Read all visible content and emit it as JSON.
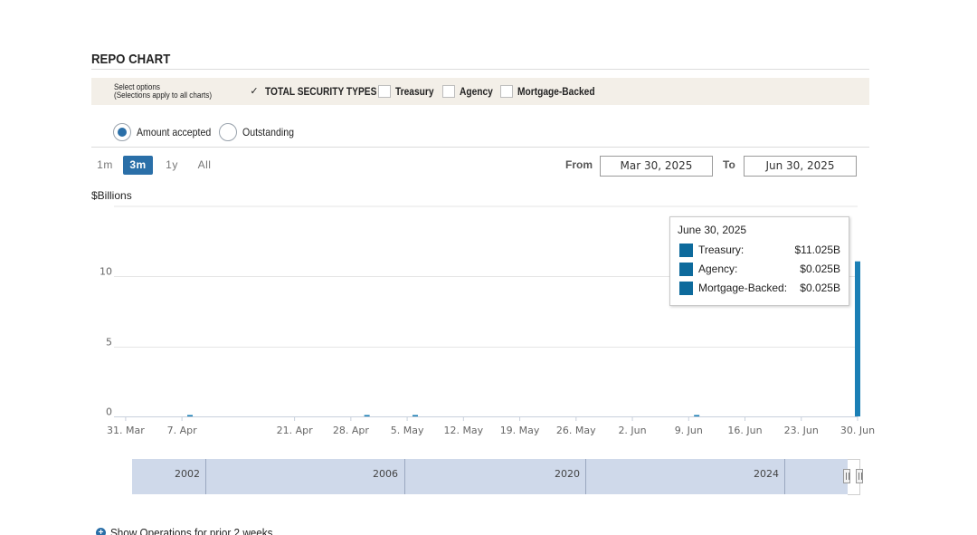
{
  "header": {
    "title": "REPO CHART"
  },
  "options": {
    "label_line1": "Select options",
    "label_line2": "(Selections apply to all charts)",
    "checkboxes": [
      {
        "label": "TOTAL SECURITY TYPES",
        "checked": true
      },
      {
        "label": "Treasury",
        "checked": false
      },
      {
        "label": "Agency",
        "checked": false
      },
      {
        "label": "Mortgage-Backed",
        "checked": false
      }
    ],
    "check_glyph": "✓"
  },
  "radios": [
    {
      "label": "Amount accepted",
      "selected": true
    },
    {
      "label": "Outstanding",
      "selected": false
    }
  ],
  "range_buttons": [
    {
      "label": "1m",
      "active": false
    },
    {
      "label": "3m",
      "active": true
    },
    {
      "label": "1y",
      "active": false
    },
    {
      "label": "All",
      "active": false
    }
  ],
  "date_range": {
    "from_label": "From",
    "from_value": "Mar 30, 2025",
    "to_label": "To",
    "to_value": "Jun 30, 2025"
  },
  "tooltip": {
    "date": "June 30, 2025",
    "rows": [
      {
        "name": "Treasury:",
        "value": "$11.025B"
      },
      {
        "name": "Agency:",
        "value": "$0.025B"
      },
      {
        "name": "Mortgage-Backed:",
        "value": "$0.025B"
      }
    ]
  },
  "navigator": {
    "years": [
      "2002",
      "2006",
      "2020",
      "2024"
    ]
  },
  "footer": {
    "ops_link": "Show Operations for prior 2 weeks",
    "ops_icon": "+"
  },
  "colors": {
    "accent": "#2a6fa8",
    "bar": "#1a7fb5",
    "tooltip_swatch": "#0d6a9c",
    "grid": "#e6e6e6",
    "navigator": "#cfd9ea"
  },
  "chart_data": {
    "type": "bar",
    "title": "",
    "ylabel": "$Billions",
    "xlabel": "",
    "x_range": [
      "2025-03-30",
      "2025-06-30"
    ],
    "ylim": [
      0,
      15
    ],
    "yticks": [
      0,
      5,
      10
    ],
    "xticks": [
      {
        "date": "2025-03-31",
        "label": "31. Mar"
      },
      {
        "date": "2025-04-07",
        "label": "7. Apr"
      },
      {
        "date": "2025-04-21",
        "label": "21. Apr"
      },
      {
        "date": "2025-04-28",
        "label": "28. Apr"
      },
      {
        "date": "2025-05-05",
        "label": "5. May"
      },
      {
        "date": "2025-05-12",
        "label": "12. May"
      },
      {
        "date": "2025-05-19",
        "label": "19. May"
      },
      {
        "date": "2025-05-26",
        "label": "26. May"
      },
      {
        "date": "2025-06-02",
        "label": "2. Jun"
      },
      {
        "date": "2025-06-09",
        "label": "9. Jun"
      },
      {
        "date": "2025-06-16",
        "label": "16. Jun"
      },
      {
        "date": "2025-06-23",
        "label": "23. Jun"
      },
      {
        "date": "2025-06-30",
        "label": "30. Jun"
      }
    ],
    "bars": [
      {
        "date": "2025-04-08",
        "value": 0.1
      },
      {
        "date": "2025-04-30",
        "value": 0.1
      },
      {
        "date": "2025-05-06",
        "value": 0.1
      },
      {
        "date": "2025-06-10",
        "value": 0.1
      },
      {
        "date": "2025-06-30",
        "value": 11.075
      }
    ],
    "grid": true,
    "legend": "none"
  }
}
